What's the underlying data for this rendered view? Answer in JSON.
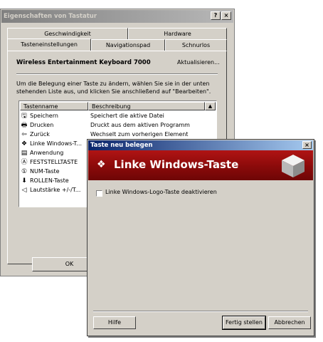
{
  "back_dialog": {
    "title": "Eigenschaften von Tastatur",
    "help_btn": "?",
    "close_btn": "×",
    "tabs_back": [
      "Geschwindigkeit",
      "Hardware"
    ],
    "tabs_front": [
      "Tasteneinstellungen",
      "Navigationspad",
      "Schnurlos"
    ],
    "device_name": "Wireless Entertainment Keyboard 7000",
    "update_link": "Aktualisieren...",
    "instructions": "Um die Belegung einer Taste zu ändern, wählen Sie sie in der unten stehenden Liste aus, und klicken Sie anschließend auf \"Bearbeiten\".",
    "col_key": "Tastenname",
    "col_desc": "Beschreibung",
    "rows": [
      {
        "icon": "floppy-icon",
        "glyph": "🖫",
        "name": "Speichern",
        "desc": "Speichert die aktive Datei"
      },
      {
        "icon": "printer-icon",
        "glyph": "🖶",
        "name": "Drucken",
        "desc": "Druckt aus dem aktiven Programm"
      },
      {
        "icon": "back-arrow-icon",
        "glyph": "⇦",
        "name": "Zurück",
        "desc": "Wechselt zum vorherigen Element"
      },
      {
        "icon": "windows-icon",
        "glyph": "❖",
        "name": "Linke Windows-T...",
        "desc": ""
      },
      {
        "icon": "application-icon",
        "glyph": "▤",
        "name": "Anwendung",
        "desc": ""
      },
      {
        "icon": "capslock-icon",
        "glyph": "Ⓐ",
        "name": "FESTSTELLTASTE",
        "desc": ""
      },
      {
        "icon": "numlock-icon",
        "glyph": "①",
        "name": "NUM-Taste",
        "desc": ""
      },
      {
        "icon": "scroll-lock-icon",
        "glyph": "⬇",
        "name": "ROLLEN-Taste",
        "desc": ""
      },
      {
        "icon": "volume-icon",
        "glyph": "◁",
        "name": "Lautstärke +/-/T...",
        "desc": ""
      }
    ],
    "ok_label": "OK"
  },
  "front_dialog": {
    "title": "Taste neu belegen",
    "close_btn": "×",
    "banner_title": "Linke Windows-Taste",
    "checkbox_label": "Linke Windows-Logo-Taste deaktivieren",
    "checkbox_checked": false,
    "help_label": "Hilfe",
    "finish_label": "Fertig stellen",
    "cancel_label": "Abbrechen"
  }
}
